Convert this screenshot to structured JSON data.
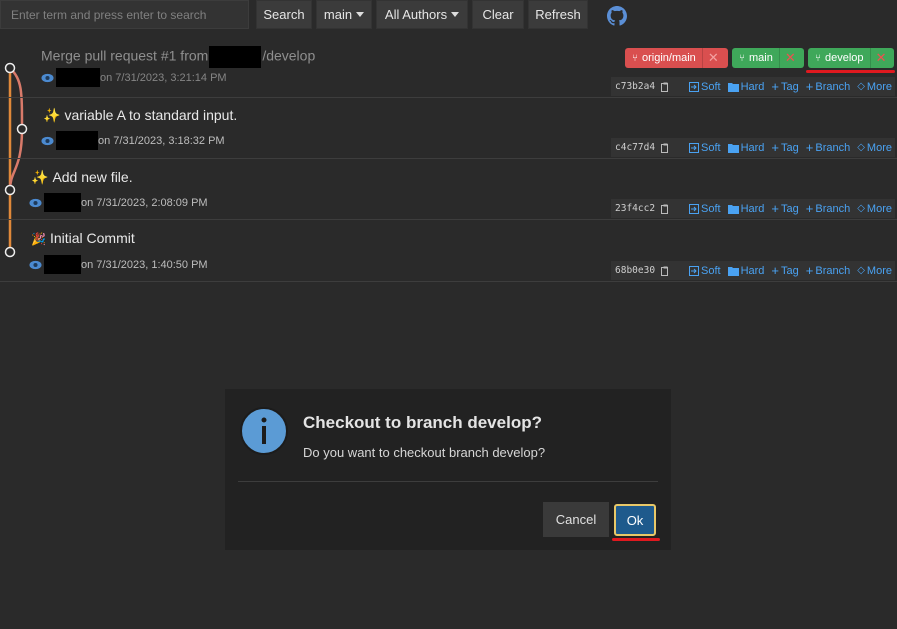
{
  "toolbar": {
    "search_placeholder": "Enter term and press enter to search",
    "search_label": "Search",
    "branch_label": "main",
    "authors_label": "All Authors",
    "clear_label": "Clear",
    "refresh_label": "Refresh"
  },
  "commits": [
    {
      "message": "Merge pull request #1 from",
      "message_suffix": "/develop",
      "emoji": "",
      "date": "on 7/31/2023, 3:21:14 PM",
      "hash": "c73b2a4"
    },
    {
      "message": "variable A to standard input.",
      "emoji": "✨",
      "date": "on 7/31/2023, 3:18:32 PM",
      "hash": "c4c77d4"
    },
    {
      "message": "Add new file.",
      "emoji": "✨",
      "date": "on 7/31/2023, 2:08:09 PM",
      "hash": "23f4cc2"
    },
    {
      "message": "Initial Commit",
      "emoji": "🎉",
      "date": "on 7/31/2023, 1:40:50 PM",
      "hash": "68b0e30"
    }
  ],
  "actions": {
    "soft": "Soft",
    "hard": "Hard",
    "tag": "Tag",
    "branch": "Branch",
    "more": "More"
  },
  "refs": [
    {
      "name": "origin/main",
      "color": "#d94f4f"
    },
    {
      "name": "main",
      "color": "#3fa85a"
    },
    {
      "name": "develop",
      "color": "#3fa85a"
    }
  ],
  "dialog": {
    "title": "Checkout to branch develop?",
    "body": "Do you want to checkout branch develop?",
    "cancel_label": "Cancel",
    "ok_label": "Ok"
  },
  "colors": {
    "accent": "#4aa2f2",
    "graph_line": "#e0893a",
    "highlight": "#e0191f"
  }
}
